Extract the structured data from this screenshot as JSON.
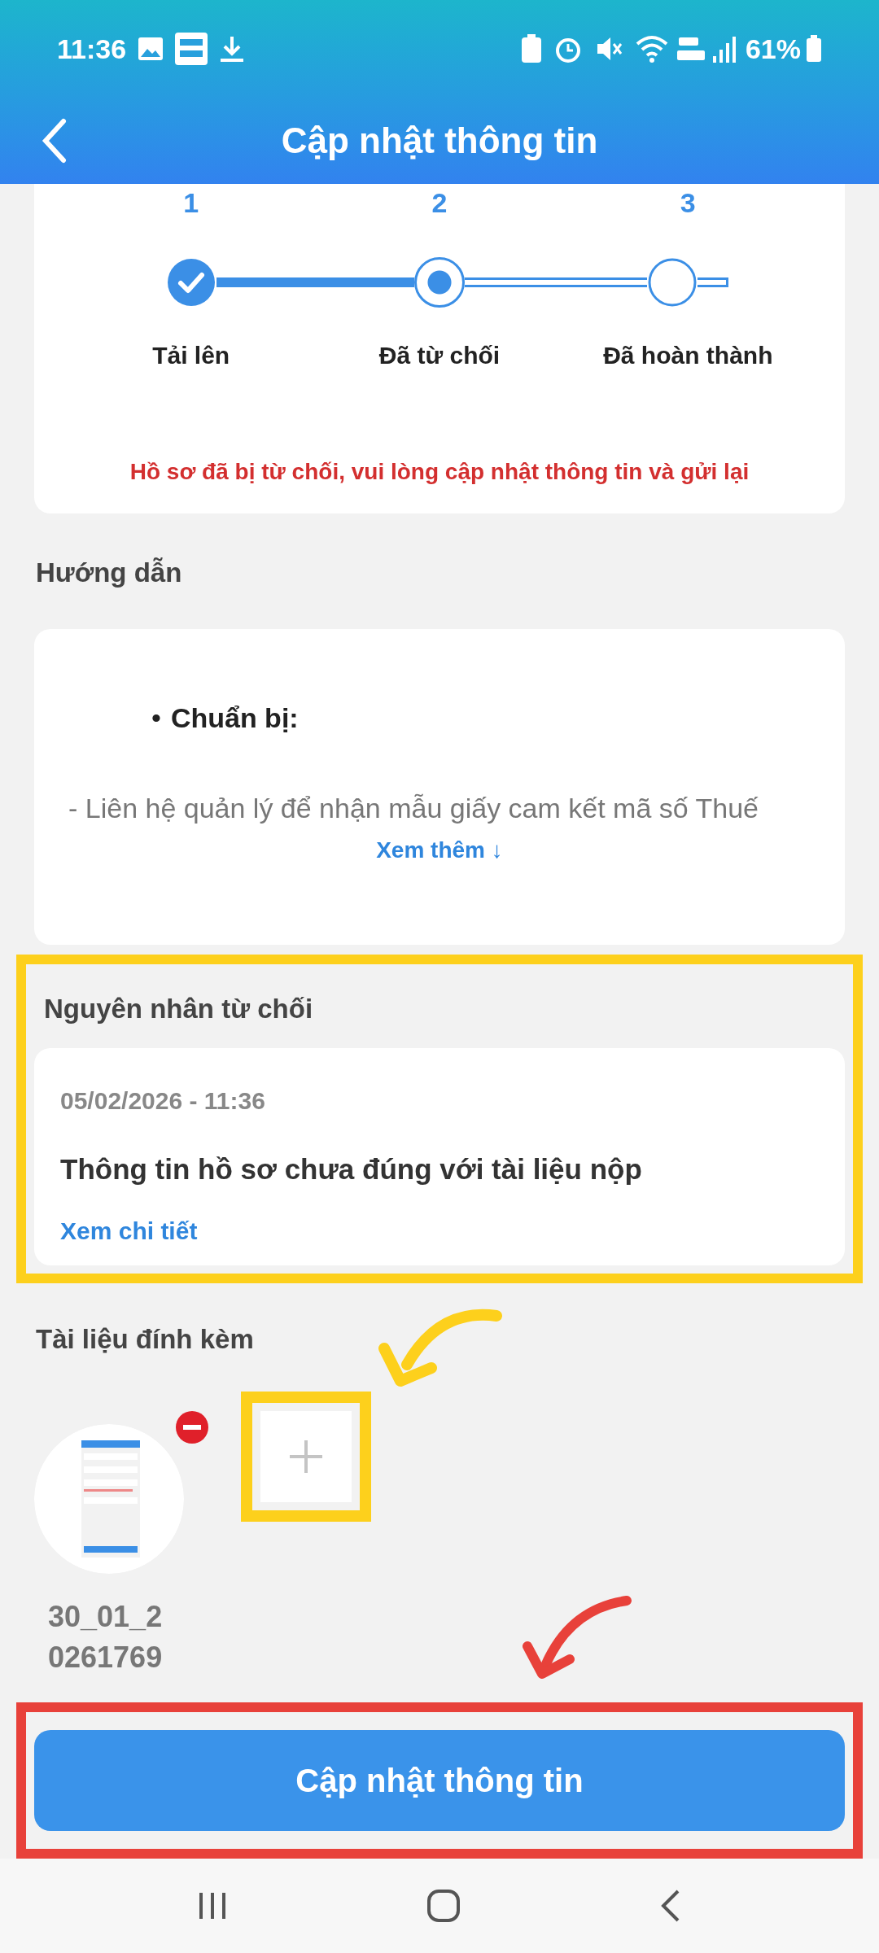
{
  "status_bar": {
    "time": "11:36",
    "battery": "61%"
  },
  "header": {
    "title": "Cập nhật thông tin"
  },
  "steps": [
    {
      "number": "1",
      "label": "Tải lên",
      "done": true,
      "selected": false
    },
    {
      "number": "2",
      "label": "Đã từ chối",
      "done": false,
      "selected": true
    },
    {
      "number": "3",
      "label": "Đã hoàn thành",
      "done": false,
      "selected": false
    }
  ],
  "notice": "Hồ sơ đã bị từ chối, vui lòng cập nhật thông tin và gửi lại",
  "guide": {
    "heading": "Hướng dẫn",
    "bullet": "•",
    "title": "Chuẩn bị:",
    "text": "- Liên hệ quản lý để nhận mẫu giấy cam kết mã số Thuế",
    "more": "Xem thêm ↓"
  },
  "rejection": {
    "heading": "Nguyên nhân từ chối",
    "date": "05/02/2026 - 11:36",
    "reason": "Thông tin hồ sơ chưa đúng với tài liệu nộp",
    "link": "Xem chi tiết"
  },
  "attachments": {
    "heading": "Tài liệu đính kèm",
    "files": [
      {
        "name": "30_01_20261769",
        "kind": "picture"
      }
    ]
  },
  "submit": "Cập nhật thông tin"
}
